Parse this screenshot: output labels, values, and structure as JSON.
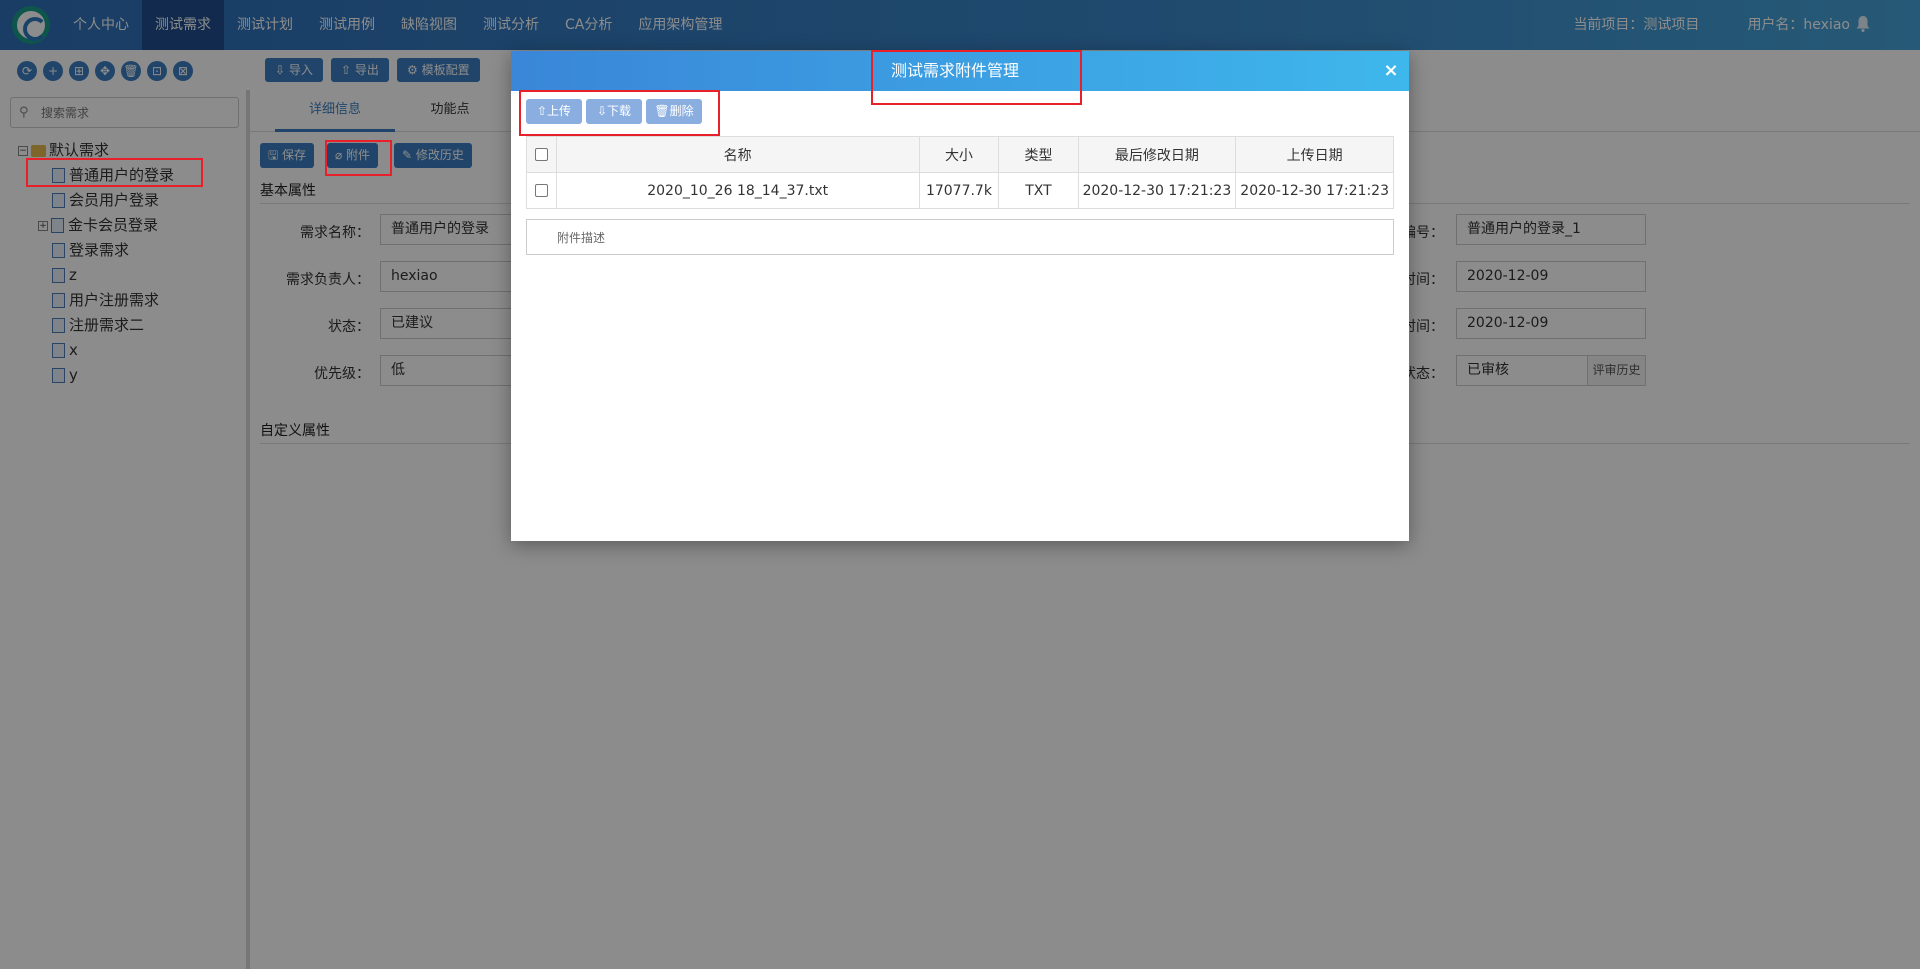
{
  "nav": {
    "items": [
      "个人中心",
      "测试需求",
      "测试计划",
      "测试用例",
      "缺陷视图",
      "测试分析",
      "CA分析",
      "应用架构管理"
    ],
    "active_index": 1,
    "current_project": "当前项目：测试项目",
    "username": "用户名：hexiao"
  },
  "left_tools": [
    "⟳",
    "+",
    "⊞",
    "✥",
    "🗑",
    "⊡",
    "⊠"
  ],
  "search": {
    "placeholder": "搜索需求"
  },
  "tree": {
    "root": "默认需求",
    "items": [
      "普通用户的登录",
      "会员用户登录",
      "金卡会员登录",
      "登录需求",
      "z",
      "用户注册需求",
      "注册需求二",
      "x",
      "y"
    ]
  },
  "toolbar": {
    "import": "导入",
    "export": "导出",
    "template": "模板配置"
  },
  "tabs": {
    "detail": "详细信息",
    "function": "功能点"
  },
  "actions": {
    "save": "保存",
    "attach": "附件",
    "history": "修改历史"
  },
  "form": {
    "section_basic": "基本属性",
    "section_custom": "自定义属性",
    "name_label": "需求名称：",
    "name_value": "普通用户的登录",
    "owner_label": "需求负责人：",
    "owner_value": "hexiao",
    "status_label": "状态：",
    "status_value": "已建议",
    "priority_label": "优先级：",
    "priority_value": "低",
    "code_label": "编号：",
    "code_value": "普通用户的登录_1",
    "time1_label": "时间：",
    "time1_value": "2020-12-09",
    "time2_label": "时间：",
    "time2_value": "2020-12-09",
    "review_label": "状态：",
    "review_value": "已审核",
    "review_history": "评审历史"
  },
  "modal": {
    "title": "测试需求附件管理",
    "upload": "上传",
    "download": "下载",
    "delete": "删除",
    "columns": [
      "名称",
      "大小",
      "类型",
      "最后修改日期",
      "上传日期"
    ],
    "rows": [
      [
        "2020_10_26 18_14_37.txt",
        "17077.7k",
        "TXT",
        "2020-12-30 17:21:23",
        "2020-12-30 17:21:23"
      ]
    ],
    "desc_placeholder": "附件描述"
  }
}
